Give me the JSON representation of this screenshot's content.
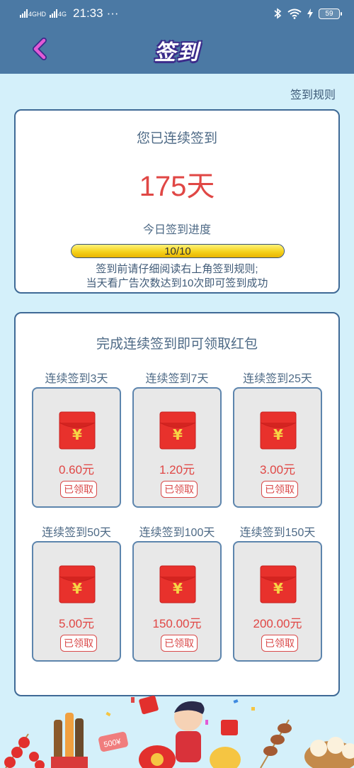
{
  "status_bar": {
    "signal_1": "4GHD",
    "signal_2": "4G",
    "time": "21:33",
    "more": "···",
    "battery": "59",
    "icons": [
      "bluetooth-icon",
      "wifi-icon",
      "charging-icon",
      "battery-icon"
    ]
  },
  "nav": {
    "title": "签到",
    "back_icon": "chevron-left-icon"
  },
  "rules_link": "签到规则",
  "streak": {
    "label": "您已连续签到",
    "value": "175天",
    "progress_label": "今日签到进度",
    "progress_text": "10/10",
    "progress_fraction": 1.0,
    "notice_line_1": "签到前请仔细阅读右上角签到规则;",
    "notice_line_2": "当天看广告次数达到10次即可签到成功"
  },
  "rewards": {
    "title": "完成连续签到即可领取红包",
    "items": [
      {
        "day_label": "连续签到3天",
        "amount": "0.60元",
        "status": "已领取"
      },
      {
        "day_label": "连续签到7天",
        "amount": "1.20元",
        "status": "已领取"
      },
      {
        "day_label": "连续签到25天",
        "amount": "3.00元",
        "status": "已领取"
      },
      {
        "day_label": "连续签到50天",
        "amount": "5.00元",
        "status": "已领取"
      },
      {
        "day_label": "连续签到100天",
        "amount": "150.00元",
        "status": "已领取"
      },
      {
        "day_label": "连续签到150天",
        "amount": "200.00元",
        "status": "已领取"
      }
    ]
  },
  "decoration": {
    "coin_label": "500¥"
  },
  "colors": {
    "header": "#4b79a4",
    "background": "#d4f0fa",
    "accent_red": "#e04745",
    "card_border": "#3f6a96",
    "progress_fill": "#f5d21c"
  }
}
